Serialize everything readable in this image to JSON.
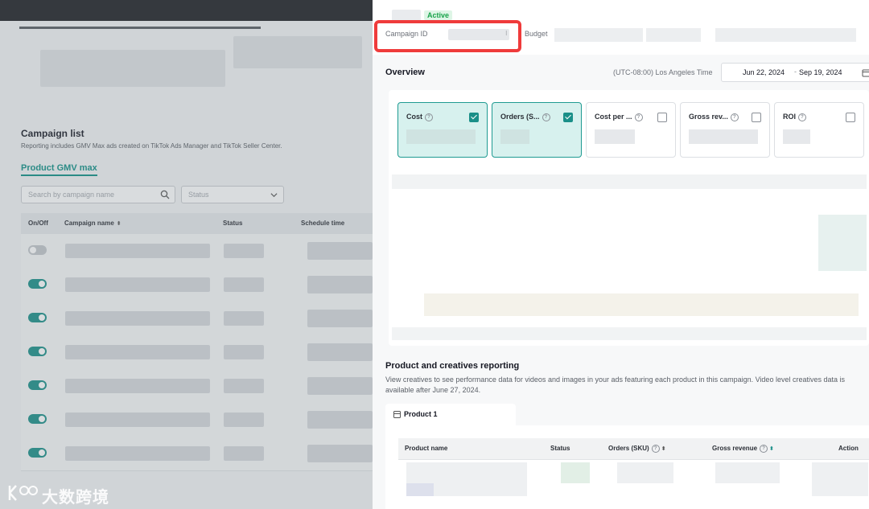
{
  "campaign_list": {
    "title": "Campaign list",
    "description": "Reporting includes GMV Max ads created on TikTok Ads Manager and TikTok Seller Center.",
    "tab_label": "Product GMV max",
    "search_placeholder": "Search by campaign name",
    "status_placeholder": "Status",
    "columns": [
      "On/Off",
      "Campaign name",
      "Status",
      "Schedule time"
    ],
    "rows": [
      {
        "enabled": false
      },
      {
        "enabled": true
      },
      {
        "enabled": true
      },
      {
        "enabled": true
      },
      {
        "enabled": true
      },
      {
        "enabled": true
      },
      {
        "enabled": true
      }
    ]
  },
  "watermark": {
    "text": "大数跨境"
  },
  "drawer": {
    "status_badge": "Active",
    "campaign_id_label": "Campaign ID",
    "budget_label": "Budget",
    "overview": {
      "title": "Overview",
      "timezone": "(UTC-08:00) Los Angeles Time",
      "date_start": "Jun 22, 2024",
      "date_separator": "-",
      "date_end": "Sep 19, 2024",
      "metrics": [
        {
          "label": "Cost",
          "checked": true
        },
        {
          "label": "Orders (S...",
          "checked": true
        },
        {
          "label": "Cost per ...",
          "checked": false
        },
        {
          "label": "Gross rev...",
          "checked": false
        },
        {
          "label": "ROI",
          "checked": false
        }
      ]
    },
    "product_reporting": {
      "title": "Product and creatives reporting",
      "description": "View creatives to see performance data for videos and images in your ads featuring each product in this campaign. Video level creatives data is available after June 27, 2024.",
      "tab_label": "Product 1",
      "columns": [
        "Product name",
        "Status",
        "Orders (SKU)",
        "Gross revenue",
        "Action"
      ]
    }
  },
  "colors": {
    "accent": "#1a8f88",
    "highlight": "#ef3b3b",
    "active_badge": "#17a34a"
  }
}
